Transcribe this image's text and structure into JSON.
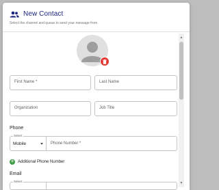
{
  "dialog": {
    "title": "New Contact",
    "subtitle": "Select the channel and queue to send your message from",
    "icon": "contacts-icon"
  },
  "avatar": {
    "icon": "person-avatar-icon",
    "delete_icon": "trash-icon"
  },
  "fields": {
    "first_name": "First Name *",
    "last_name": "Last Name",
    "organization": "Organization",
    "job_title": "Job Title"
  },
  "phone": {
    "section_label": "Phone",
    "type_legend": "Select",
    "type_value": "Mobile",
    "number_placeholder": "Phone Number *",
    "add_label": "Additional Phone Number"
  },
  "email": {
    "section_label": "Email",
    "type_legend": "Select"
  },
  "colors": {
    "title": "#1a237e",
    "delete": "#e53935",
    "add": "#43a047"
  }
}
